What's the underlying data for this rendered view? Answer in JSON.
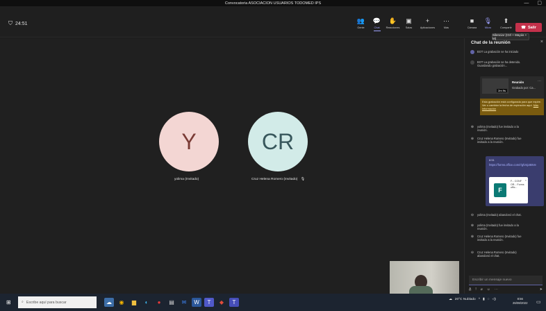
{
  "window": {
    "title": "Convocatoria ASOCIACION USUARIOS TODOMED IPS",
    "minimize": "—",
    "restore": "▢"
  },
  "meeting": {
    "timer": "24:51"
  },
  "toolbar": {
    "items": [
      {
        "label": "Gente",
        "icon": "people-icon",
        "glyph": "👥"
      },
      {
        "label": "Chat",
        "icon": "chat-icon",
        "glyph": "💬",
        "active": true
      },
      {
        "label": "Reacciones",
        "icon": "reactions-icon",
        "glyph": "✋"
      },
      {
        "label": "Salas",
        "icon": "rooms-icon",
        "glyph": "▣"
      },
      {
        "label": "Aplicaciones",
        "icon": "apps-icon",
        "glyph": "+"
      },
      {
        "label": "Más",
        "icon": "more-icon",
        "glyph": "⋯"
      }
    ],
    "media": [
      {
        "label": "Cámara",
        "icon": "camera-icon",
        "glyph": "■"
      },
      {
        "label": "Micro",
        "icon": "mic-icon",
        "glyph": "🎙"
      },
      {
        "label": "Compartir",
        "icon": "share-icon",
        "glyph": "⬆"
      }
    ],
    "leave_label": "Salir",
    "tooltip": "Silenciar (Ctrl + Mayús + M)"
  },
  "participants": [
    {
      "initials": "Y",
      "name": "yolima (Invitado)"
    },
    {
      "initials": "CR",
      "name": "Cruz Helena Romero (Invitado)"
    }
  ],
  "chat": {
    "title": "Chat de la reunión",
    "close": "×",
    "messages": [
      "BOT  La grabación se ha iniciado",
      "BOT  La grabación se ha detenido. Guardando grabación...",
      "yolima (Invitado) fue invitado a la reunión.",
      "Cruz Helena Romero (Invitado) fue invitado a la reunión.",
      "yolima (Invitado) abandonó el chat.",
      "yolima (Invitado) fue invitado a la reunión.",
      "Cruz Helena Romero (Invitado) fue invitado a la reunión.",
      "Cruz Helena Romero (Invitado) abandonó el chat."
    ],
    "recording": {
      "title": "Reunión",
      "by": "Grabado por: Ca...",
      "duration": "2m 9s",
      "warning": "Esta grabación está configurada para que expire. Ver o cambiar la fecha de expiración aquí.",
      "warning_link": "Más información",
      "more": "⋯"
    },
    "link": {
      "sender": "8:51",
      "url": "https://forms.office.com/r/gfv5jc8BVe",
      "preview_title": "F... CONF OR... Forms offic...",
      "preview_close": "×"
    },
    "compose_placeholder": "Escribir un mensaje nuevo"
  },
  "taskbar": {
    "search_placeholder": "Escribe aquí para buscar",
    "weather": "20°C  Nublado",
    "time": "8:56",
    "date": "26/08/2022"
  }
}
